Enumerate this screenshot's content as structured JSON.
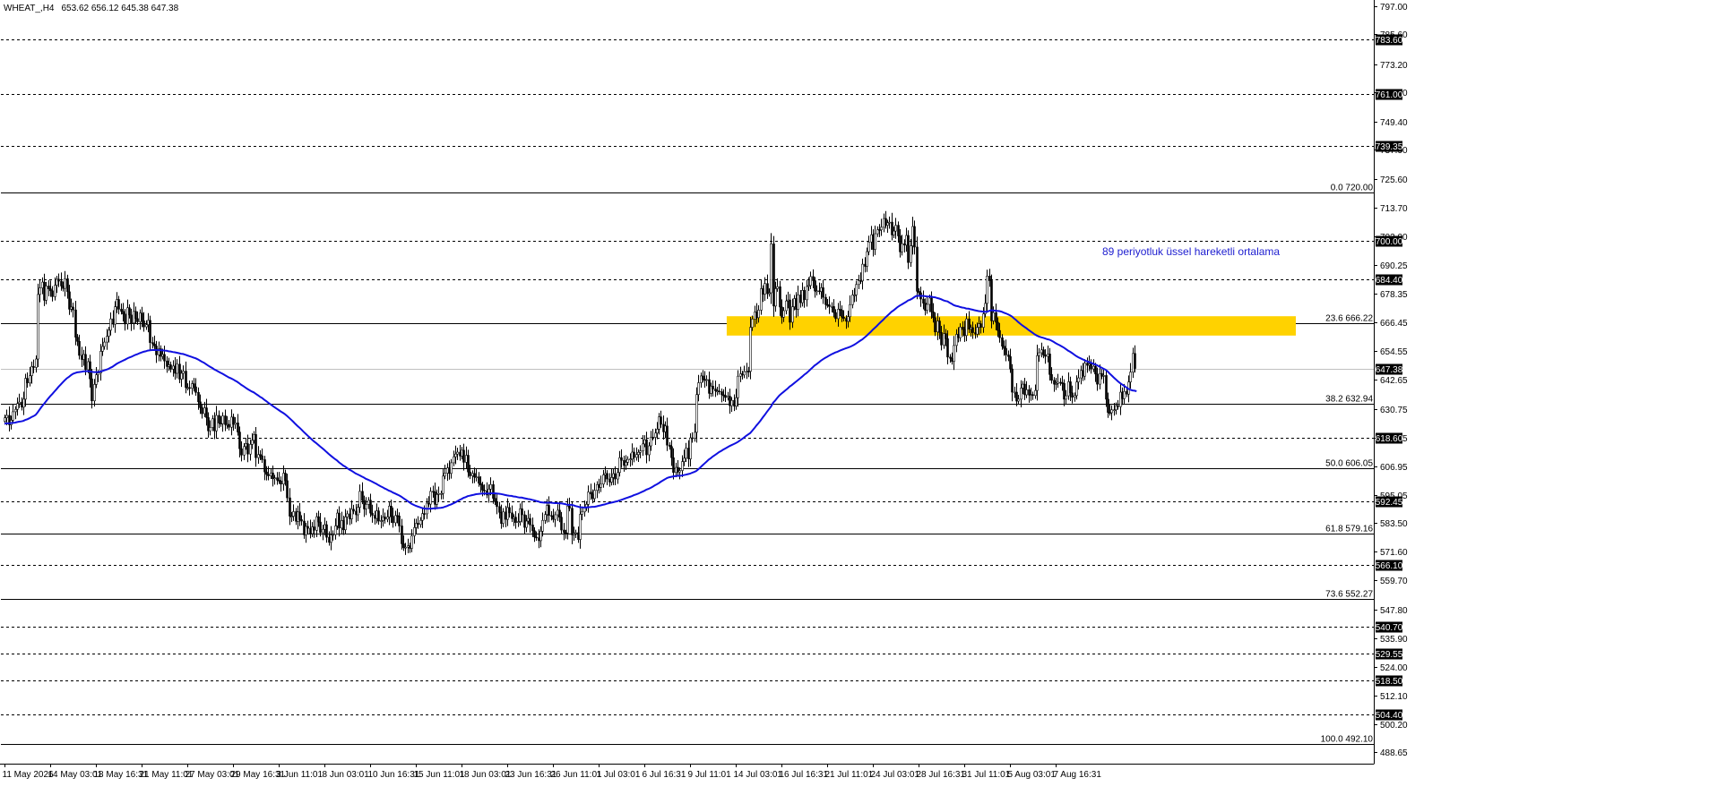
{
  "header": {
    "symbol": "WHEAT_,H4",
    "ohlc": "653.62 656.12 645.38 647.38"
  },
  "colors": {
    "background": "#ffffff",
    "candle": "#000000",
    "ema": "#1010e0",
    "zone": "#ffd200",
    "annotation": "#2020d0",
    "dashed_level": "#000000",
    "fib_line": "#000000"
  },
  "chart_data": {
    "type": "candlestick",
    "symbol": "WHEAT_",
    "timeframe": "H4",
    "ylim": [
      484.0,
      799.0
    ],
    "y_ticks": [
      797.0,
      785.6,
      773.2,
      761.6,
      749.4,
      737.9,
      725.6,
      713.7,
      702.0,
      690.25,
      678.35,
      666.45,
      654.55,
      642.65,
      630.75,
      618.85,
      606.95,
      595.05,
      583.5,
      571.6,
      559.7,
      547.8,
      535.9,
      524.0,
      512.1,
      500.2,
      488.65
    ],
    "y_tick_labels": [
      "797.00",
      "785.60",
      "773.20",
      "761.60",
      "749.40",
      "737.90",
      "725.60",
      "713.70",
      "702.00",
      "690.25",
      "678.35",
      "666.45",
      "654.55",
      "642.65",
      "630.75",
      "618.85",
      "606.95",
      "595.05",
      "583.50",
      "571.60",
      "559.70",
      "547.80",
      "535.90",
      "524.00",
      "512.10",
      "500.20",
      "488.65"
    ],
    "x_labels": [
      "11 May 2026",
      "14 May 03:01",
      "18 May 16:31",
      "21 May 11:01",
      "27 May 03:01",
      "29 May 16:31",
      "3 Jun 11:01",
      "8 Jun 03:01",
      "10 Jun 16:31",
      "15 Jun 11:01",
      "18 Jun 03:01",
      "23 Jun 16:31",
      "26 Jun 11:01",
      "1 Jul 03:01",
      "6 Jul 16:31",
      "9 Jul 11:01",
      "14 Jul 03:01",
      "16 Jul 16:31",
      "21 Jul 11:01",
      "24 Jul 03:01",
      "28 Jul 16:31",
      "31 Jul 11:01",
      "5 Aug 03:01",
      "7 Aug 16:31"
    ],
    "price_levels": [
      {
        "price": 783.6,
        "label": "783.60"
      },
      {
        "price": 761.0,
        "label": "761.00"
      },
      {
        "price": 739.35,
        "label": "739.35"
      },
      {
        "price": 700.0,
        "label": "700.00"
      },
      {
        "price": 684.4,
        "label": "684.40"
      },
      {
        "price": 618.6,
        "label": "618.60"
      },
      {
        "price": 592.45,
        "label": "592.45"
      },
      {
        "price": 566.1,
        "label": "566.10"
      },
      {
        "price": 540.7,
        "label": "540.70"
      },
      {
        "price": 529.55,
        "label": "529.55"
      },
      {
        "price": 518.5,
        "label": "518.50"
      },
      {
        "price": 504.4,
        "label": "504.40"
      }
    ],
    "current_price": {
      "price": 647.38,
      "label": "647.38"
    },
    "fibonacci": [
      {
        "price": 720.0,
        "label": "0.0 720.00"
      },
      {
        "price": 666.22,
        "label": "23.6 666.22"
      },
      {
        "price": 632.94,
        "label": "38.2 632.94"
      },
      {
        "price": 606.05,
        "label": "50.0 606.05"
      },
      {
        "price": 579.16,
        "label": "61.8 579.16"
      },
      {
        "price": 552.27,
        "label": "73.6 552.27"
      },
      {
        "price": 492.1,
        "label": "100.0 492.10"
      }
    ],
    "resistance_zone": {
      "from": 661.0,
      "to": 669.0,
      "start": "14 Jul 03:01"
    },
    "annotation": "89 periyotluk üssel hareketli ortalama",
    "ema_name": "89 periyotluk üssel hareketli ortalama",
    "closes": [
      627.0,
      628.0,
      624.1,
      626.0,
      629.5,
      630.5,
      632.9,
      633.5,
      631.4,
      634.7,
      643.3,
      641.4,
      644.4,
      648.2,
      647.8,
      651.3,
      678.0,
      680.7,
      683.1,
      675.6,
      681.5,
      680.3,
      679.5,
      677.1,
      681.8,
      684.3,
      683.5,
      681.5,
      680.5,
      684.5,
      679.1,
      671.9,
      672.8,
      671.6,
      660.3,
      658.6,
      652.8,
      651.1,
      653.2,
      646.9,
      650.2,
      643.1,
      634.0,
      640.8,
      644.8,
      645.5,
      654.5,
      656.5,
      658.3,
      660.7,
      663.2,
      667.9,
      665.7,
      672.9,
      675.9,
      671.9,
      671.0,
      669.9,
      665.8,
      672.5,
      669.5,
      666.2,
      671.0,
      668.0,
      666.7,
      670.3,
      667.1,
      664.6,
      665.5,
      667.3,
      658.1,
      657.5,
      656.7,
      653.0,
      655.5,
      652.4,
      653.2,
      650.5,
      648.2,
      648.9,
      647.1,
      648.4,
      645.4,
      649.2,
      643.0,
      645.4,
      646.3,
      639.5,
      639.5,
      639.2,
      641.1,
      639.8,
      637.5,
      633.6,
      631.2,
      628.7,
      631.1,
      627.1,
      621.6,
      623.0,
      626.6,
      621.6,
      628.0,
      624.8,
      624.5,
      627.8,
      624.2,
      624.3,
      623.1,
      627.3,
      624.3,
      624.9,
      621.1,
      614.2,
      611.6,
      615.1,
      616.3,
      612.0,
      616.0,
      617.7,
      620.1,
      610.5,
      611.8,
      611.3,
      609.7,
      604.6,
      603.6,
      603.0,
      604.2,
      601.8,
      602.2,
      601.2,
      600.9,
      599.6,
      604.1,
      601.0,
      593.9,
      586.3,
      586.3,
      588.2,
      584.2,
      588.1,
      584.9,
      584.3,
      578.6,
      582.1,
      581.3,
      579.1,
      581.9,
      580.5,
      586.1,
      583.9,
      579.5,
      580.9,
      582.8,
      577.6,
      575.5,
      578.6,
      578.7,
      582.3,
      587.6,
      581.4,
      584.5,
      580.7,
      586.0,
      587.3,
      585.2,
      589.2,
      588.4,
      586.9,
      590.0,
      596.6,
      592.8,
      589.3,
      591.2,
      592.9,
      587.6,
      586.7,
      585.4,
      588.5,
      584.3,
      584.5,
      586.0,
      585.1,
      586.0,
      590.5,
      586.3,
      583.6,
      586.6,
      586.4,
      582.3,
      574.9,
      573.3,
      573.5,
      574.1,
      573.0,
      578.2,
      581.6,
      583.4,
      582.9,
      584.6,
      587.4,
      587.3,
      591.7,
      591.3,
      596.6,
      596.4,
      591.2,
      595.3,
      595.7,
      595.7,
      602.9,
      604.1,
      606.3,
      604.0,
      608.4,
      610.9,
      612.0,
      612.8,
      611.2,
      613.6,
      608.6,
      611.5,
      604.6,
      603.0,
      604.0,
      602.5,
      602.6,
      599.9,
      599.2,
      597.1,
      596.8,
      595.1,
      597.5,
      599.4,
      593.7,
      592.3,
      590.3,
      587.9,
      583.3,
      588.1,
      585.0,
      589.9,
      587.7,
      585.3,
      585.9,
      583.7,
      584.1,
      589.4,
      586.9,
      581.7,
      584.3,
      585.4,
      582.7,
      580.3,
      577.7,
      577.4,
      576.2,
      580.1,
      584.6,
      587.0,
      590.8,
      586.6,
      586.4,
      585.0,
      586.9,
      588.8,
      585.9,
      580.6,
      579.5,
      579.4,
      590.5,
      589.6,
      578.6,
      579.1,
      579.5,
      576.7,
      587.1,
      588.1,
      589.8,
      591.2,
      596.3,
      595.5,
      593.6,
      597.0,
      599.4,
      598.2,
      599.6,
      603.4,
      604.0,
      601.7,
      600.4,
      602.3,
      603.9,
      601.7,
      604.4,
      610.5,
      609.4,
      607.3,
      608.6,
      609.8,
      610.0,
      612.8,
      610.6,
      611.8,
      612.7,
      613.3,
      616.2,
      617.9,
      611.7,
      615.4,
      619.0,
      618.9,
      620.7,
      622.3,
      627.4,
      624.3,
      621.2,
      623.6,
      615.7,
      615.1,
      610.5,
      604.4,
      606.5,
      604.6,
      605.2,
      608.9,
      610.3,
      614.5,
      610.0,
      618.7,
      618.5,
      621.0,
      636.6,
      641.5,
      644.3,
      642.9,
      642.5,
      642.8,
      637.1,
      640.1,
      638.9,
      638.1,
      638.1,
      637.8,
      636.5,
      636.3,
      635.4,
      635.9,
      632.0,
      634.2,
      631.8,
      635.3,
      644.2,
      645.2,
      644.7,
      646.1,
      646.3,
      646.2,
      664.4,
      667.8,
      670.8,
      668.4,
      671.5,
      680.4,
      678.1,
      682.5,
      678.3,
      678.7,
      698.9,
      673.2,
      680.4,
      681.2,
      672.8,
      668.6,
      671.3,
      675.3,
      675.7,
      666.5,
      672.9,
      676.3,
      671.8,
      677.8,
      674.6,
      679.7,
      675.8,
      681.3,
      681.7,
      685.4,
      683.7,
      679.4,
      679.5,
      679.2,
      680.8,
      676.8,
      673.8,
      673.7,
      673.0,
      673.0,
      670.5,
      668.0,
      671.9,
      671.5,
      668.6,
      668.1,
      666.9,
      668.8,
      673.8,
      677.8,
      677.8,
      682.1,
      683.7,
      683.6,
      690.5,
      689.6,
      695.7,
      699.7,
      702.7,
      696.6,
      703.1,
      704.8,
      704.7,
      705.8,
      709.4,
      706.6,
      707.6,
      707.9,
      702.6,
      704.2,
      706.6,
      702.2,
      695.6,
      699.0,
      698.4,
      702.4,
      691.2,
      698.1,
      706.1,
      697.6,
      679.3,
      678.7,
      676.1,
      674.4,
      671.4,
      673.9,
      676.5,
      670.8,
      668.4,
      662.5,
      667.0,
      662.3,
      657.1,
      661.8,
      659.7,
      652.1,
      651.6,
      650.3,
      656.9,
      661.5,
      660.1,
      664.5,
      663.5,
      661.0,
      667.9,
      663.6,
      664.3,
      662.2,
      661.6,
      664.4,
      665.9,
      664.4,
      670.0,
      674.3,
      685.6,
      683.7,
      667.1,
      670.5,
      666.5,
      663.1,
      660.1,
      656.6,
      655.7,
      653.0,
      652.3,
      647.2,
      637.6,
      637.6,
      633.9,
      634.7,
      639.3,
      640.9,
      636.5,
      638.6,
      636.4,
      636.6,
      636.2,
      638.3,
      652.7,
      653.9,
      655.1,
      653.0,
      652.4,
      653.4,
      644.9,
      642.5,
      640.9,
      641.2,
      641.7,
      641.5,
      641.2,
      634.7,
      636.1,
      641.9,
      637.3,
      635.5,
      636.2,
      641.8,
      643.5,
      646.6,
      644.2,
      649.6,
      648.7,
      649.3,
      647.2,
      648.3,
      645.1,
      640.9,
      645.3,
      644.2,
      644.5,
      634.7,
      629.2,
      629.1,
      630.3,
      630.3,
      632.0,
      631.6,
      637.6,
      634.9,
      637.9,
      636.8,
      641.8,
      645.9,
      653.6,
      647.4
    ],
    "ema": [
      624.6,
      624.7,
      624.7,
      624.8,
      624.9,
      625.0,
      625.2,
      625.4,
      625.5,
      625.7,
      626.1,
      626.4,
      626.8,
      627.3,
      627.7,
      628.2,
      629.3,
      630.5,
      631.7,
      632.7,
      633.8,
      634.9,
      635.9,
      636.8,
      637.8,
      638.8,
      639.8,
      640.7,
      641.6,
      642.5,
      643.3,
      643.9,
      644.6,
      645.2,
      645.5,
      645.8,
      645.9,
      646.0,
      646.2,
      646.2,
      646.3,
      646.2,
      646.0,
      645.9,
      645.9,
      645.9,
      646.1,
      646.3,
      646.6,
      646.9,
      647.2,
      647.7,
      648.1,
      648.7,
      649.3,
      649.8,
      650.2,
      650.6,
      651.0,
      651.5,
      651.9,
      652.2,
      652.6,
      653.0,
      653.3,
      653.7,
      654.0,
      654.3,
      654.5,
      654.8,
      654.9,
      655.0,
      655.0,
      655.0,
      655.0,
      654.9,
      654.9,
      654.8,
      654.7,
      654.5,
      654.4,
      654.2,
      654.1,
      653.9,
      653.7,
      653.5,
      653.4,
      653.1,
      652.8,
      652.5,
      652.2,
      651.9,
      651.6,
      651.2,
      650.7,
      650.2,
      649.8,
      649.2,
      648.6,
      648.1,
      647.6,
      647.0,
      646.6,
      646.1,
      645.6,
      645.2,
      644.7,
      644.2,
      643.7,
      643.3,
      642.9,
      642.4,
      641.9,
      641.3,
      640.6,
      640.1,
      639.5,
      638.9,
      638.4,
      637.9,
      637.5,
      636.9,
      636.3,
      635.7,
      635.2,
      634.5,
      633.9,
      633.2,
      632.6,
      632.0,
      631.4,
      630.8,
      630.2,
      629.6,
      629.1,
      628.5,
      627.8,
      627.0,
      626.2,
      625.4,
      624.5,
      623.7,
      622.9,
      622.1,
      621.2,
      620.4,
      619.6,
      618.8,
      618.0,
      617.2,
      616.6,
      615.9,
      615.1,
      614.4,
      613.7,
      612.9,
      612.1,
      611.4,
      610.7,
      610.0,
      609.4,
      608.6,
      608.0,
      607.3,
      606.8,
      606.2,
      605.6,
      605.1,
      604.6,
      604.0,
      603.6,
      603.2,
      602.7,
      602.3,
      601.8,
      601.4,
      601.0,
      600.6,
      600.1,
      599.7,
      599.2,
      598.7,
      598.3,
      597.8,
      597.4,
      596.9,
      596.6,
      596.1,
      595.7,
      595.3,
      594.9,
      594.4,
      593.8,
      593.2,
      592.6,
      592.0,
      591.4,
      591.0,
      590.6,
      590.3,
      590.0,
      589.7,
      589.5,
      589.4,
      589.4,
      589.4,
      589.5,
      589.6,
      589.6,
      589.7,
      589.8,
      589.9,
      590.2,
      590.5,
      590.9,
      591.2,
      591.6,
      592.0,
      592.5,
      593.0,
      593.4,
      593.9,
      594.2,
      594.6,
      594.8,
      595.0,
      595.2,
      595.4,
      595.5,
      595.6,
      595.7,
      595.7,
      595.7,
      595.7,
      595.8,
      595.8,
      595.8,
      595.7,
      595.6,
      595.5,
      595.3,
      595.1,
      594.9,
      594.8,
      594.7,
      594.5,
      594.4,
      594.2,
      594.0,
      594.0,
      593.8,
      593.6,
      593.4,
      593.3,
      593.1,
      592.9,
      592.6,
      592.4,
      592.1,
      592.0,
      591.9,
      591.9,
      591.9,
      591.9,
      591.8,
      591.7,
      591.7,
      591.6,
      591.6,
      591.5,
      591.3,
      591.0,
      591.0,
      591.0,
      590.8,
      590.5,
      590.3,
      590.0,
      590.0,
      589.9,
      589.9,
      590.0,
      590.1,
      590.2,
      590.2,
      590.4,
      590.6,
      590.8,
      591.0,
      591.2,
      591.5,
      591.7,
      591.9,
      592.1,
      592.3,
      592.5,
      592.8,
      593.1,
      593.4,
      593.7,
      594.0,
      594.3,
      594.6,
      595.0,
      595.3,
      595.6,
      596.0,
      596.4,
      596.8,
      597.3,
      597.6,
      598.0,
      598.5,
      599.0,
      599.5,
      600.0,
      600.6,
      601.1,
      601.6,
      602.1,
      602.4,
      602.6,
      602.8,
      602.9,
      603.0,
      603.0,
      603.1,
      603.3,
      603.5,
      603.7,
      603.9,
      604.3,
      604.6,
      605.0,
      605.7,
      606.5,
      607.3,
      608.1,
      608.9,
      609.7,
      610.3,
      611.0,
      611.6,
      612.2,
      612.8,
      613.3,
      613.8,
      614.3,
      614.8,
      615.3,
      615.7,
      616.1,
      616.5,
      617.0,
      617.6,
      618.2,
      618.8,
      619.5,
      620.1,
      620.7,
      621.7,
      622.7,
      623.8,
      624.8,
      625.9,
      627.1,
      628.2,
      629.4,
      630.5,
      631.6,
      633.2,
      634.1,
      635.2,
      636.2,
      637.0,
      637.7,
      638.4,
      639.1,
      639.9,
      640.5,
      641.2,
      641.9,
      642.6,
      643.3,
      644.0,
      644.8,
      645.4,
      646.2,
      647.0,
      647.8,
      648.6,
      649.2,
      649.9,
      650.6,
      651.2,
      651.7,
      652.2,
      652.7,
      653.2,
      653.6,
      654.0,
      654.3,
      654.7,
      655.1,
      655.4,
      655.7,
      656.0,
      656.3,
      656.7,
      657.2,
      657.7,
      658.3,
      658.9,
      659.4,
      660.2,
      660.9,
      661.7,
      662.5,
      663.4,
      664.2,
      665.0,
      665.9,
      666.7,
      667.5,
      668.4,
      669.2,
      670.0,
      670.8,
      671.4,
      672.1,
      672.8,
      673.4,
      673.9,
      674.4,
      674.9,
      675.5,
      675.8,
      676.3,
      676.9,
      677.4,
      677.4,
      677.4,
      677.4,
      677.3,
      677.2,
      677.1,
      677.1,
      676.9,
      676.8,
      676.5,
      676.3,
      676.0,
      675.6,
      675.3,
      675.1,
      674.6,
      674.1,
      673.6,
      673.3,
      673.1,
      672.8,
      672.6,
      672.5,
      672.2,
      672.1,
      671.9,
      671.7,
      671.5,
      671.3,
      671.1,
      671.0,
      670.9,
      670.8,
      670.9,
      671.2,
      671.5,
      671.4,
      671.3,
      671.2,
      671.1,
      670.9,
      670.5,
      670.2,
      669.8,
      669.4,
      668.9,
      668.1,
      667.4,
      666.6,
      665.9,
      665.2,
      664.6,
      664.0,
      663.3,
      662.7,
      662.1,
      661.5,
      661.0,
      660.6,
      660.3,
      660.1,
      659.8,
      659.5,
      659.3,
      658.9,
      658.4,
      657.9,
      657.4,
      657.0,
      656.5,
      656.0,
      655.4,
      654.8,
      654.3,
      653.7,
      653.1,
      652.5,
      652.0,
      651.6,
      651.2,
      650.8,
      650.4,
      650.1,
      649.8,
      649.4,
      649.1,
      648.7,
      648.2,
      647.8,
      647.3,
      646.9,
      646.2,
      645.3,
      644.5,
      643.7,
      642.9,
      642.1,
      641.4,
      640.8,
      640.2,
      639.6,
      639.0,
      638.6,
      638.3,
      638.2,
      638.0
    ]
  }
}
